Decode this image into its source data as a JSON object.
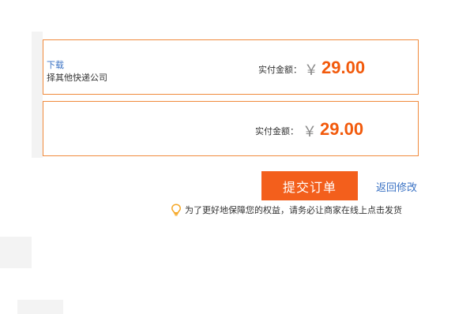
{
  "order_box_1": {
    "link_partial": "下载",
    "company_partial": "择其他快递公司",
    "pay_label": "实付金额：",
    "currency": "￥",
    "amount": "29.00"
  },
  "order_box_2": {
    "pay_label": "实付金额：",
    "currency": "￥",
    "amount": "29.00"
  },
  "actions": {
    "submit_label": "提交订单",
    "back_label": "返回修改"
  },
  "notice": {
    "text": "为了更好地保障您的权益，请务必让商家在线上点击发货",
    "icon": "lightbulb-icon"
  },
  "colors": {
    "accent": "#f35f1c",
    "border": "#f08a3c",
    "link": "#3a72c4"
  }
}
